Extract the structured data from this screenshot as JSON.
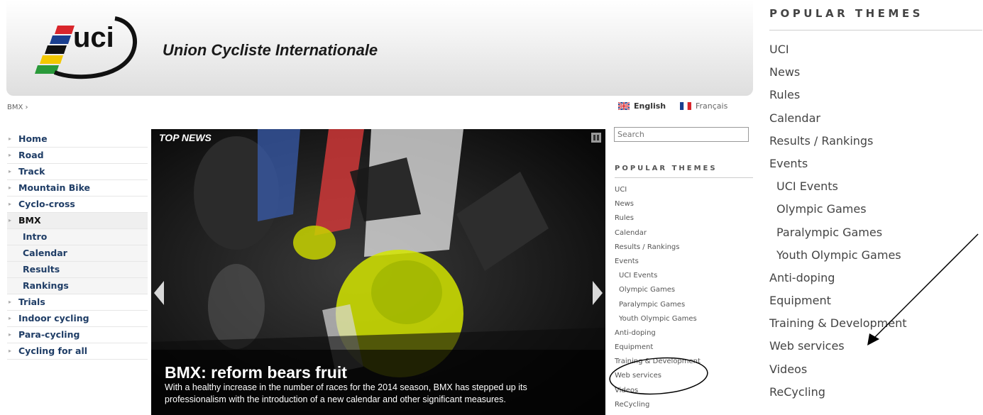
{
  "header": {
    "org_name": "Union Cycliste Internationale",
    "logo_text": "uci"
  },
  "breadcrumb": "BMX ›",
  "languages": {
    "english": "English",
    "french": "Français"
  },
  "left_nav": [
    {
      "label": "Home",
      "type": "main"
    },
    {
      "label": "Road",
      "type": "main"
    },
    {
      "label": "Track",
      "type": "main"
    },
    {
      "label": "Mountain Bike",
      "type": "main"
    },
    {
      "label": "Cyclo-cross",
      "type": "main"
    },
    {
      "label": "BMX",
      "type": "active"
    },
    {
      "label": "Intro",
      "type": "sub"
    },
    {
      "label": "Calendar",
      "type": "sub"
    },
    {
      "label": "Results",
      "type": "sub"
    },
    {
      "label": "Rankings",
      "type": "sub"
    },
    {
      "label": "Trials",
      "type": "main"
    },
    {
      "label": "Indoor cycling",
      "type": "main"
    },
    {
      "label": "Para-cycling",
      "type": "main"
    },
    {
      "label": "Cycling for all",
      "type": "main"
    }
  ],
  "slideshow": {
    "label": "TOP NEWS",
    "headline": "BMX: reform bears fruit",
    "text": "With a healthy increase in the number of races for the 2014 season, BMX has stepped up its professionalism with the introduction of a new calendar and other significant measures."
  },
  "search": {
    "placeholder": "Search"
  },
  "popular_themes": {
    "title": "POPULAR THEMES",
    "items": [
      {
        "label": "UCI",
        "indent": false
      },
      {
        "label": "News",
        "indent": false
      },
      {
        "label": "Rules",
        "indent": false
      },
      {
        "label": "Calendar",
        "indent": false
      },
      {
        "label": "Results / Rankings",
        "indent": false
      },
      {
        "label": "Events",
        "indent": false
      },
      {
        "label": "UCI Events",
        "indent": true
      },
      {
        "label": "Olympic Games",
        "indent": true
      },
      {
        "label": "Paralympic Games",
        "indent": true
      },
      {
        "label": "Youth Olympic Games",
        "indent": true
      },
      {
        "label": "Anti-doping",
        "indent": false
      },
      {
        "label": "Equipment",
        "indent": false
      },
      {
        "label": "Training & Development",
        "indent": false
      },
      {
        "label": "Web services",
        "indent": false
      },
      {
        "label": "Videos",
        "indent": false
      },
      {
        "label": "ReCycling",
        "indent": false
      }
    ]
  },
  "colors": {
    "nav_text": "#1f3d66",
    "header_gradient_end": "#dedede"
  }
}
